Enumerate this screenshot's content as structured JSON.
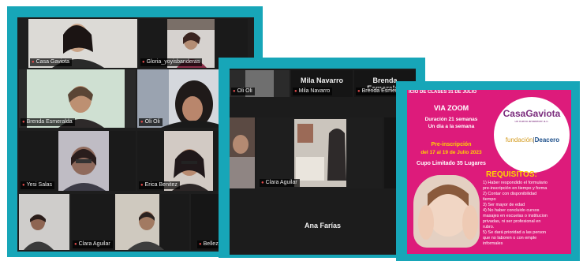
{
  "window_left": {
    "tiles": [
      {
        "name": "Casa Gaviota"
      },
      {
        "name": "Gloria_yoyisbanderas"
      },
      {
        "name": "Brenda Esmeralda"
      },
      {
        "name": "Oli Oli"
      },
      {
        "name": "Yesi Salas"
      },
      {
        "name": "Erica Benitez"
      },
      {
        "name": "Clara Aguilar"
      },
      {
        "name": "Belleza"
      }
    ]
  },
  "window_middle": {
    "top_names": [
      "Oli Oli",
      "Mila Navarro",
      "Brenda Esmeralda"
    ],
    "top_labels": [
      "Mila Navarro",
      "Brenda Esmeralda"
    ],
    "active_name": "Clara Aguilar",
    "bottom_name": "Ana Farías"
  },
  "flyer": {
    "header": "ICIO DE CLASES 31 DE JULIO",
    "via": "VIA ZOOM",
    "duration": "Duración 21 semanas",
    "frequency": "Un dia a la semana",
    "pre_title": "Pre-inscripción",
    "pre_dates": "del 17 al 19 de Julio 2023",
    "cupo": "Cupo Limitado 35 Lugares",
    "requisitos": "REQUISITOS:",
    "req_lines": [
      "1) Haber respondido el formulario",
      "pre-inscripción en tiempo y forma",
      "2) Contar con disponibilidad",
      "tiempo",
      "3) Ser mayor de edad",
      "4) No haber concluido cursos",
      "masajes en escuelas o institucion",
      "privadas, ni ser profesional en",
      "rubro.",
      "5) Se dará prioridad a las person",
      "que no laboren o con emple",
      "informales"
    ],
    "logo1": "CasaGaviota",
    "logo1_sub": "un nuevo amanecer a.c.",
    "logo2_a": "fundación",
    "logo2_b": "Deacero"
  },
  "colors": {
    "frame": "#17a6b8",
    "flyer": "#dd1b7b",
    "accent_yellow": "#ffd400",
    "active_border": "#c8e26a"
  }
}
